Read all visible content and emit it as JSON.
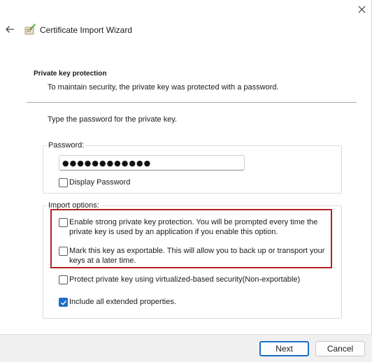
{
  "window": {
    "title": "Certificate Import Wizard",
    "icons": {
      "close": "close-icon",
      "back": "back-arrow-icon",
      "wizard": "certificate-wizard-icon"
    }
  },
  "section": {
    "title": "Private key protection",
    "description": "To maintain security, the private key was protected with a password."
  },
  "instruction": "Type the password for the private key.",
  "password": {
    "legend": "Password:",
    "value": "●●●●●●●●●●●●",
    "display_password_label": "Display Password",
    "display_password_checked": false
  },
  "import_options": {
    "legend": "Import options:",
    "items": [
      {
        "label": "Enable strong private key protection. You will be prompted every time the private key is used by an application if you enable this option.",
        "checked": false
      },
      {
        "label": "Mark this key as exportable. This will allow you to back up or transport your keys at a later time.",
        "checked": false
      },
      {
        "label": "Protect private key using virtualized-based security(Non-exportable)",
        "checked": false
      },
      {
        "label": "Include all extended properties.",
        "checked": true
      }
    ]
  },
  "buttons": {
    "next": "Next",
    "cancel": "Cancel"
  },
  "colors": {
    "accent": "#1f6fc6",
    "highlight_border": "#b22222"
  }
}
